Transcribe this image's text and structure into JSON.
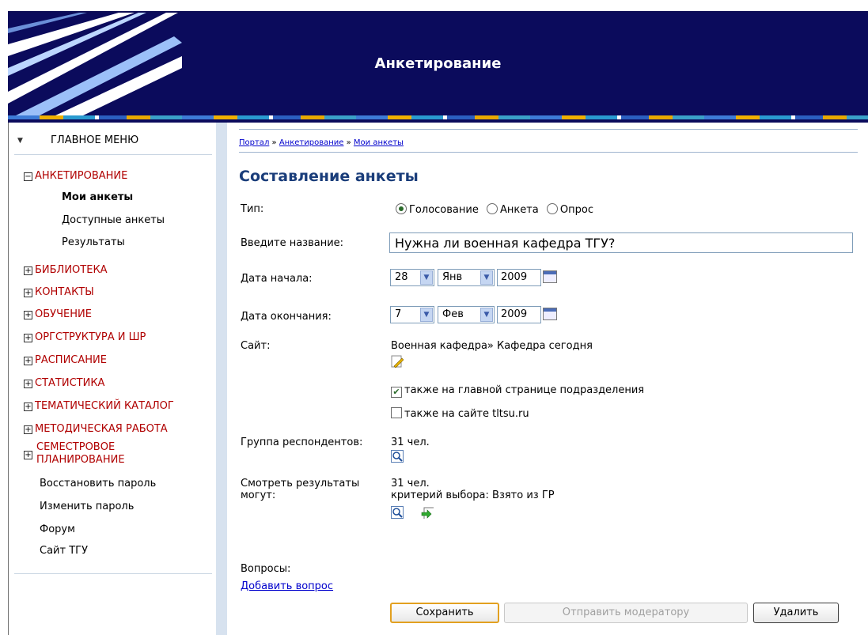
{
  "header": {
    "title": "Анкетирование"
  },
  "sidebar": {
    "menu_title": "ГЛАВНОЕ МЕНЮ",
    "sections": [
      {
        "label": "АНКЕТИРОВАНИЕ",
        "expanded": true
      },
      {
        "label": "БИБЛИОТЕКА",
        "expanded": false
      },
      {
        "label": "КОНТАКТЫ",
        "expanded": false
      },
      {
        "label": "ОБУЧЕНИЕ",
        "expanded": false
      },
      {
        "label": "ОРГСТРУКТУРА И ШР",
        "expanded": false
      },
      {
        "label": "РАСПИСАНИЕ",
        "expanded": false
      },
      {
        "label": "СТАТИСТИКА",
        "expanded": false
      },
      {
        "label": "ТЕМАТИЧЕСКИЙ КАТАЛОГ",
        "expanded": false
      },
      {
        "label": "МЕТОДИЧЕСКАЯ РАБОТА",
        "expanded": false
      },
      {
        "label_line1": "СЕМЕСТРОВОЕ",
        "label_line2": "ПЛАНИРОВАНИЕ",
        "expanded": false
      }
    ],
    "subitems": [
      {
        "label": "Мои анкеты",
        "active": true
      },
      {
        "label": "Доступные анкеты",
        "active": false
      },
      {
        "label": "Результаты",
        "active": false
      }
    ],
    "links": [
      "Восстановить пароль",
      "Изменить пароль",
      "Форум",
      "Сайт ТГУ"
    ]
  },
  "breadcrumb": {
    "items": [
      "Портал",
      "Анкетирование",
      "Мои анкеты"
    ],
    "separator": "»"
  },
  "form": {
    "page_title": "Составление анкеты",
    "type_label": "Тип:",
    "type_options": [
      "Голосование",
      "Анкета",
      "Опрос"
    ],
    "type_selected": "Голосование",
    "name_label": "Введите название:",
    "name_value": "Нужна ли военная кафедра ТГУ?",
    "start_label": "Дата начала:",
    "start_day": "28",
    "start_month": "Янв",
    "start_year": "2009",
    "end_label": "Дата окончания:",
    "end_day": "7",
    "end_month": "Фев",
    "end_year": "2009",
    "site_label": "Сайт:",
    "site_value": "Военная кафедра» Кафедра сегодня",
    "check_main_page": {
      "label": "также на главной странице подразделения",
      "checked": true
    },
    "check_site": {
      "label": "также на сайте tltsu.ru",
      "checked": false
    },
    "group_label": "Группа респондентов:",
    "group_value": "31 чел.",
    "view_label_line1": "Смотреть результаты",
    "view_label_line2": "могут:",
    "view_count": "31 чел.",
    "view_criteria": "критерий выбора: Взято из ГР",
    "questions_label": "Вопросы:",
    "add_question": "Добавить вопрос"
  },
  "buttons": {
    "save": "Сохранить",
    "moderator": "Отправить модератору",
    "delete": "Удалить"
  },
  "colors": {
    "banner": "#0b0b5c",
    "section_red": "#b00000",
    "title_blue": "#1a3d7a",
    "link_blue": "#0000cc"
  }
}
